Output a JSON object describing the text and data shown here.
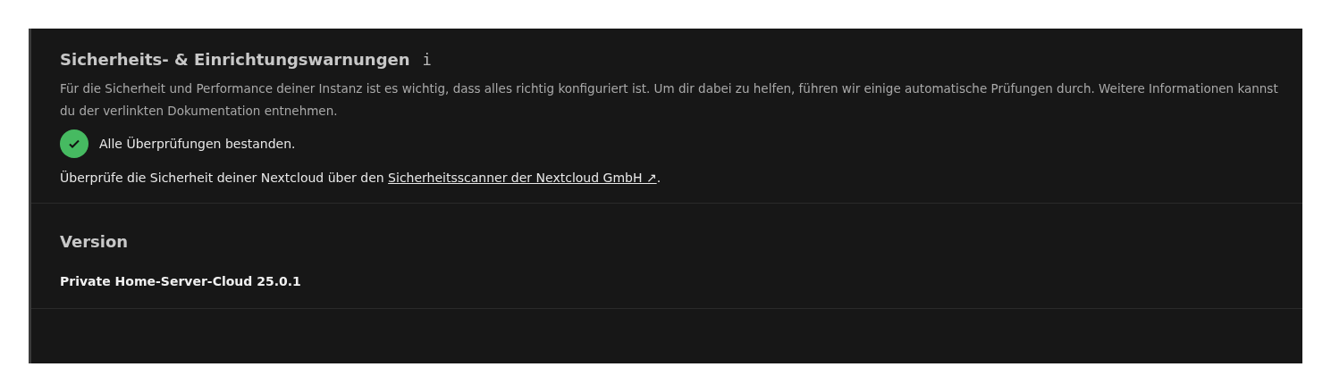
{
  "security": {
    "title": "Sicherheits- & Einrichtungswarnungen",
    "info_icon": "i",
    "description": "Für die Sicherheit und Performance deiner Instanz ist es wichtig, dass alles richtig konfiguriert ist. Um dir dabei zu helfen, führen wir einige automatische Prüfungen durch. Weitere Informationen kannst du der verlinkten Dokumentation entnehmen.",
    "status": {
      "passed": true,
      "text": "Alle Überprüfungen bestanden."
    },
    "scan": {
      "before": "Überprüfe die Sicherheit deiner Nextcloud über den ",
      "link": "Sicherheitsscanner der Nextcloud GmbH ↗",
      "after": "."
    }
  },
  "version": {
    "title": "Version",
    "value": "Private Home-Server-Cloud 25.0.1"
  }
}
